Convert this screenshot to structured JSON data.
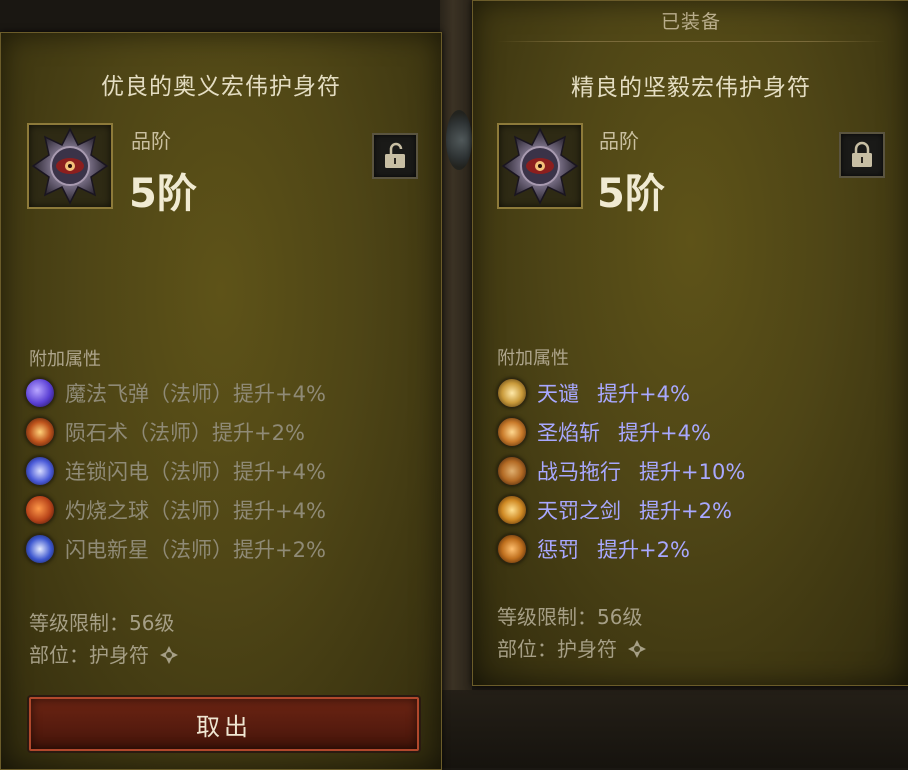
{
  "left_item": {
    "title": "优良的奥义宏伟护身符",
    "grade_label": "品阶",
    "grade_value": "5阶",
    "lock_state": "unlocked",
    "affix_header": "附加属性",
    "affixes": [
      {
        "text": "魔法飞弹（法师）提升+4%",
        "icon": "magic-missile-icon",
        "color": "#5a3fd4"
      },
      {
        "text": "陨石术（法师）提升+2%",
        "icon": "meteor-icon",
        "color": "#c0551d"
      },
      {
        "text": "连锁闪电（法师）提升+4%",
        "icon": "chain-lightning-icon",
        "color": "#4a5ad8"
      },
      {
        "text": "灼烧之球（法师）提升+4%",
        "icon": "fireball-icon",
        "color": "#b8441a"
      },
      {
        "text": "闪电新星（法师）提升+2%",
        "icon": "lightning-nova-icon",
        "color": "#3e58d0"
      }
    ],
    "level_req": "等级限制：56级",
    "slot": "部位：护身符",
    "take_out_label": "取出"
  },
  "right_item": {
    "equipped_label": "已装备",
    "title": "精良的坚毅宏伟护身符",
    "grade_label": "品阶",
    "grade_value": "5阶",
    "lock_state": "locked",
    "affix_header": "附加属性",
    "affixes": [
      {
        "name": "天谴",
        "value": "提升+4%",
        "icon": "judgment-icon",
        "color": "#c99a3a"
      },
      {
        "name": "圣焰斩",
        "value": "提升+4%",
        "icon": "holy-flame-slash-icon",
        "color": "#c97a2a"
      },
      {
        "name": "战马拖行",
        "value": "提升+10%",
        "icon": "warhorse-drag-icon",
        "color": "#b36a24"
      },
      {
        "name": "天罚之剑",
        "value": "提升+2%",
        "icon": "sword-of-judgment-icon",
        "color": "#d08a24"
      },
      {
        "name": "惩罚",
        "value": "提升+2%",
        "icon": "punish-icon",
        "color": "#c0701e"
      }
    ],
    "level_req": "等级限制：56级",
    "slot": "部位：护身符"
  },
  "colors": {
    "panel_bg": "#4e4516",
    "magic_affix": "#a8a8ff",
    "inactive_affix": "#8f8a76",
    "button_red": "#561b0e"
  }
}
